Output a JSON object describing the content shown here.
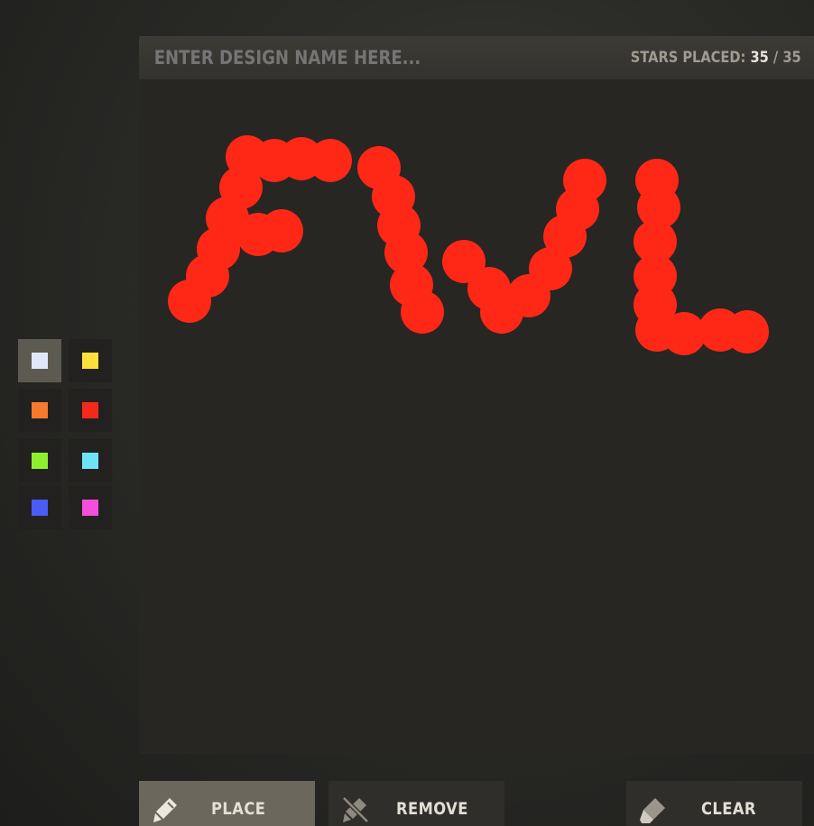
{
  "header": {
    "design_name_placeholder": "ENTER DESIGN NAME HERE...",
    "stars_label": "STARS PLACED:",
    "stars_placed": "35",
    "stars_separator": "/",
    "stars_max": "35"
  },
  "palette": {
    "selected_index": 0,
    "colors": [
      {
        "name": "white",
        "hex": "#dfe8fa"
      },
      {
        "name": "yellow",
        "hex": "#fde13a"
      },
      {
        "name": "orange",
        "hex": "#f57a2e"
      },
      {
        "name": "red",
        "hex": "#f5291a"
      },
      {
        "name": "green",
        "hex": "#8df02f"
      },
      {
        "name": "cyan",
        "hex": "#6ee3f6"
      },
      {
        "name": "blue",
        "hex": "#4a5cf5"
      },
      {
        "name": "magenta",
        "hex": "#f44fdb"
      }
    ]
  },
  "canvas": {
    "star_color": "#ff2817",
    "letters_drawn": "FVL"
  },
  "toolbar": {
    "place_label": "PLACE",
    "remove_label": "REMOVE",
    "clear_label": "CLEAR",
    "active_tool": "place"
  }
}
